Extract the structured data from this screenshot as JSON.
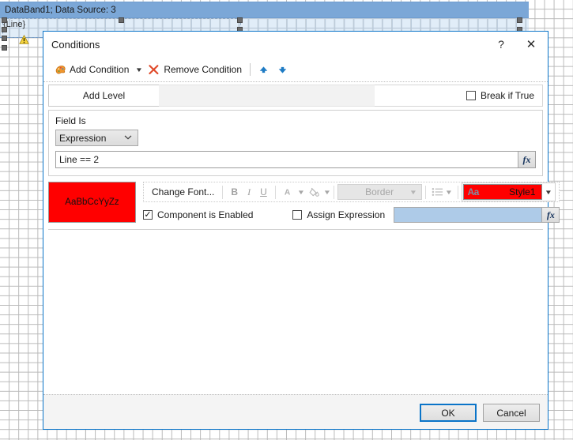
{
  "designer": {
    "band_header": "DataBand1; Data Source: 3",
    "band_text": "{Line}"
  },
  "dialog": {
    "title": "Conditions",
    "help_glyph": "?",
    "close_glyph": "✕",
    "toolbar": {
      "add_condition": "Add Condition",
      "add_condition_caret": "▼",
      "remove_condition": "Remove Condition",
      "move_up": "▲",
      "move_down": "▼"
    },
    "levels": {
      "add_level": "Add Level",
      "break_if_true": "Break if True",
      "break_if_true_checked": false
    },
    "condition": {
      "field_is_label": "Field Is",
      "field_is_value": "Expression",
      "field_is_chevron": "⌄",
      "expression_value": "Line == 2",
      "expression_placeholder": "",
      "fx_label": "fx"
    },
    "format": {
      "preview_text": "AaBbCcYyZz",
      "preview_bg": "#ff0000",
      "change_font": "Change Font...",
      "bold": "B",
      "italic": "I",
      "underline": "U",
      "font_color": "A",
      "highlight_color": "◇",
      "caret": "▼",
      "border": "Border",
      "border_chevron": "▼",
      "bullets_caret": "▼",
      "style_aa": "Aa",
      "style_name": "Style1",
      "style_caret": "▼",
      "component_enabled_label": "Component is Enabled",
      "component_enabled_checked": true,
      "assign_expression_label": "Assign Expression",
      "assign_expression_checked": false,
      "assign_expression_value": "",
      "assign_fx_label": "fx",
      "check_tick": "✓"
    },
    "footer": {
      "ok": "OK",
      "cancel": "Cancel"
    }
  },
  "colors": {
    "accent": "#0a74c8",
    "band": "#7ba7d7",
    "style_red": "#ff0000",
    "assign_blue": "#aecbe8"
  }
}
